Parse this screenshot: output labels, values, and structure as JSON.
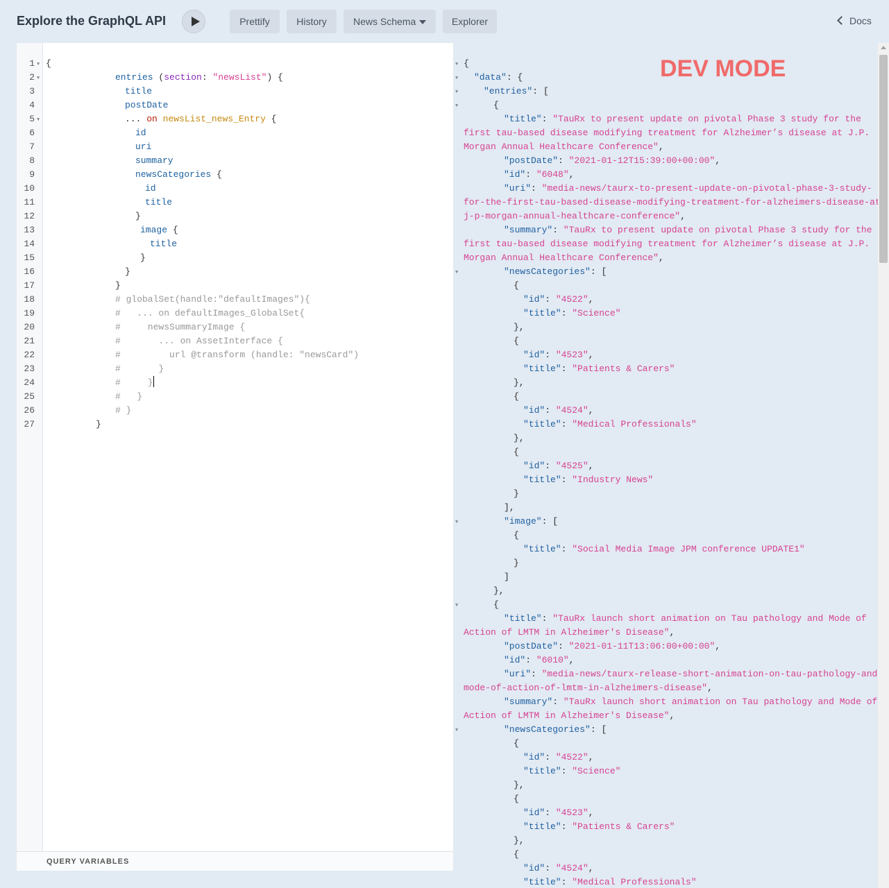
{
  "header": {
    "title": "Explore the GraphQL API",
    "buttons": {
      "prettify": "Prettify",
      "history": "History",
      "schema": "News Schema",
      "explorer": "Explorer"
    },
    "docs": "Docs"
  },
  "editor": {
    "line_numbers": [
      "1",
      "2",
      "3",
      "4",
      "5",
      "6",
      "7",
      "8",
      "9",
      "10",
      "11",
      "12",
      "13",
      "14",
      "15",
      "16",
      "17",
      "18",
      "19",
      "20",
      "21",
      "22",
      "23",
      "24",
      "25",
      "26",
      "27"
    ],
    "query_variables_label": "QUERY VARIABLES",
    "tokens": {
      "l1": "{",
      "l2_field": "entries",
      "l2_paren": " (",
      "l2_arg": "section",
      "l2_colon": ": ",
      "l2_val": "\"newsList\"",
      "l2_close": ") {",
      "l3": "title",
      "l4": "postDate",
      "l5_dots": "... ",
      "l5_on": "on",
      "l5_type": "newsList_news_Entry",
      "l5_brace": " {",
      "l6": "id",
      "l7": "uri",
      "l8": "summary",
      "l9": "newsCategories",
      "l9_brace": " {",
      "l10": "id",
      "l11": "title",
      "l12": "}",
      "l13": "image",
      "l13_brace": " {",
      "l14": "title",
      "l15": "}",
      "l16": "}",
      "l17": "}",
      "l18": "# globalSet(handle:\"defaultImages\"){",
      "l19": "#   ... on defaultImages_GlobalSet{",
      "l20": "#     newsSummaryImage {",
      "l21": "#       ... on AssetInterface {",
      "l22": "#         url @transform (handle: \"newsCard\")",
      "l23": "#       }",
      "l24": "#     }",
      "l25": "#   }",
      "l26": "# }",
      "l27": "}"
    }
  },
  "result": {
    "dev_mode": "DEV MODE",
    "t": {
      "open": "{",
      "data_key": "\"data\"",
      "entries_key": "\"entries\"",
      "colon_sp": ": ",
      "open_brace": "{",
      "open_bracket": "[",
      "comma": ",",
      "close_brace": "}",
      "close_brace_c": "},",
      "close_bracket": "]",
      "close_bracket_c": "],",
      "title_key": "\"title\"",
      "postDate_key": "\"postDate\"",
      "id_key": "\"id\"",
      "uri_key": "\"uri\"",
      "summary_key": "\"summary\"",
      "newsCategories_key": "\"newsCategories\"",
      "image_key": "\"image\"",
      "e1_title_a": "\"TauRx to present update on pivotal Phase 3 study for the",
      "e1_title_b": "first tau-based disease modifying treatment for Alzheimer’s disease at J.P.",
      "e1_title_c": "Morgan Annual Healthcare Conference\"",
      "e1_postDate": "\"2021-01-12T15:39:00+00:00\"",
      "e1_id": "\"6048\"",
      "e1_uri_a": "\"media-news/taurx-to-present-update-on-pivotal-phase-3-study-",
      "e1_uri_b": "for-the-first-tau-based-disease-modifying-treatment-for-alzheimers-disease-at-",
      "e1_uri_c": "j-p-morgan-annual-healthcare-conference\"",
      "e1_summary_a": "\"TauRx to present update on pivotal Phase 3 study for the",
      "e1_summary_b": "first tau-based disease modifying treatment for Alzheimer’s disease at J.P.",
      "e1_summary_c": "Morgan Annual Healthcare Conference\"",
      "cat_id_4522": "\"4522\"",
      "cat_title_science": "\"Science\"",
      "cat_id_4523": "\"4523\"",
      "cat_title_patients": "\"Patients & Carers\"",
      "cat_id_4524": "\"4524\"",
      "cat_title_medical": "\"Medical Professionals\"",
      "cat_id_4525": "\"4525\"",
      "cat_title_industry": "\"Industry News\"",
      "e1_image_title": "\"Social Media Image JPM conference UPDATE1\"",
      "e2_title_a": "\"TauRx launch short animation on Tau pathology and Mode of",
      "e2_title_b": "Action of LMTM in Alzheimer's Disease\"",
      "e2_postDate": "\"2021-01-11T13:06:00+00:00\"",
      "e2_id": "\"6010\"",
      "e2_uri_a": "\"media-news/taurx-release-short-animation-on-tau-pathology-and-",
      "e2_uri_b": "mode-of-action-of-lmtm-in-alzheimers-disease\"",
      "e2_summary_a": "\"TauRx launch short animation on Tau pathology and Mode of",
      "e2_summary_b": "Action of LMTM in Alzheimer's Disease\""
    }
  }
}
